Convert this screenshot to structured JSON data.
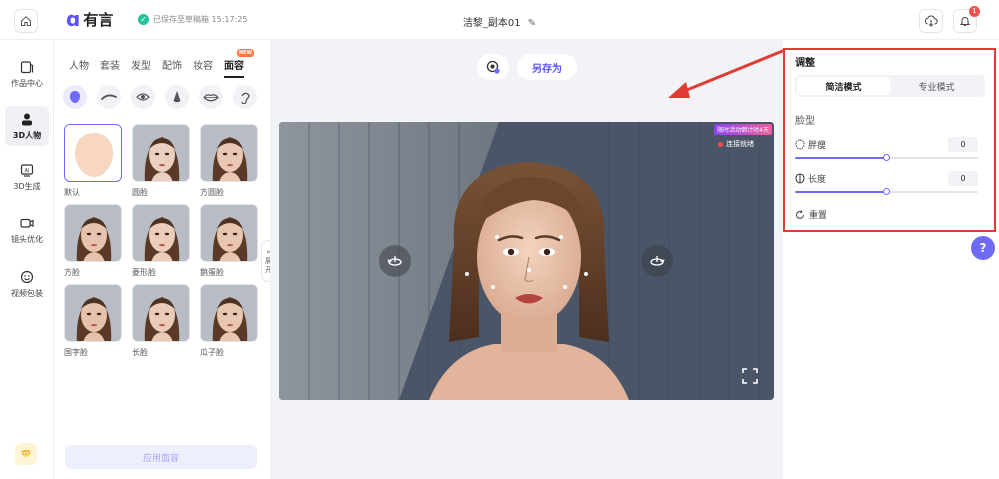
{
  "header": {
    "logo_text": "有言",
    "save_status": "已保存至草稿箱 15:17:25",
    "doc_title": "洁黎_副本01",
    "notification_count": "1"
  },
  "leftnav": {
    "items": [
      {
        "label": "作品中心",
        "icon": "folder-icon"
      },
      {
        "label": "3D人物",
        "icon": "person-icon"
      },
      {
        "label": "3D生成",
        "icon": "ai-icon"
      },
      {
        "label": "镜头优化",
        "icon": "camera-icon"
      },
      {
        "label": "视频包装",
        "icon": "emoji-icon"
      }
    ],
    "active_index": 1
  },
  "panel": {
    "tabs": [
      "人物",
      "套装",
      "发型",
      "配饰",
      "妆容",
      "面容"
    ],
    "active_tab": 5,
    "new_badge": "NEW",
    "features": [
      "face-shape-icon",
      "eyebrow-icon",
      "eye-icon",
      "nose-icon",
      "lips-icon",
      "ear-icon"
    ],
    "thumbnails": [
      {
        "label": "默认"
      },
      {
        "label": "圆脸"
      },
      {
        "label": "方圆脸"
      },
      {
        "label": "方脸"
      },
      {
        "label": "菱形脸"
      },
      {
        "label": "鹅蛋脸"
      },
      {
        "label": "国字脸"
      },
      {
        "label": "长脸"
      },
      {
        "label": "瓜子脸"
      }
    ],
    "apply_label": "应用面容",
    "expand_label": [
      "»",
      "展",
      "开"
    ]
  },
  "canvas": {
    "save_as_label": "另存为",
    "live_badge": "限时活动倒计时4天",
    "conn_status": "连接就绪"
  },
  "adjust": {
    "title": "调整",
    "modes": [
      "简洁模式",
      "专业模式"
    ],
    "active_mode": 0,
    "section": "脸型",
    "params": [
      {
        "label": "胖瘦",
        "value": "0",
        "fill": 0.5
      },
      {
        "label": "长度",
        "value": "0",
        "fill": 0.5
      }
    ],
    "reset_label": "重置",
    "help_label": "?"
  },
  "colors": {
    "accent": "#6f6bf6",
    "brand": "#5b54f5",
    "highlight": "#e23b34"
  }
}
